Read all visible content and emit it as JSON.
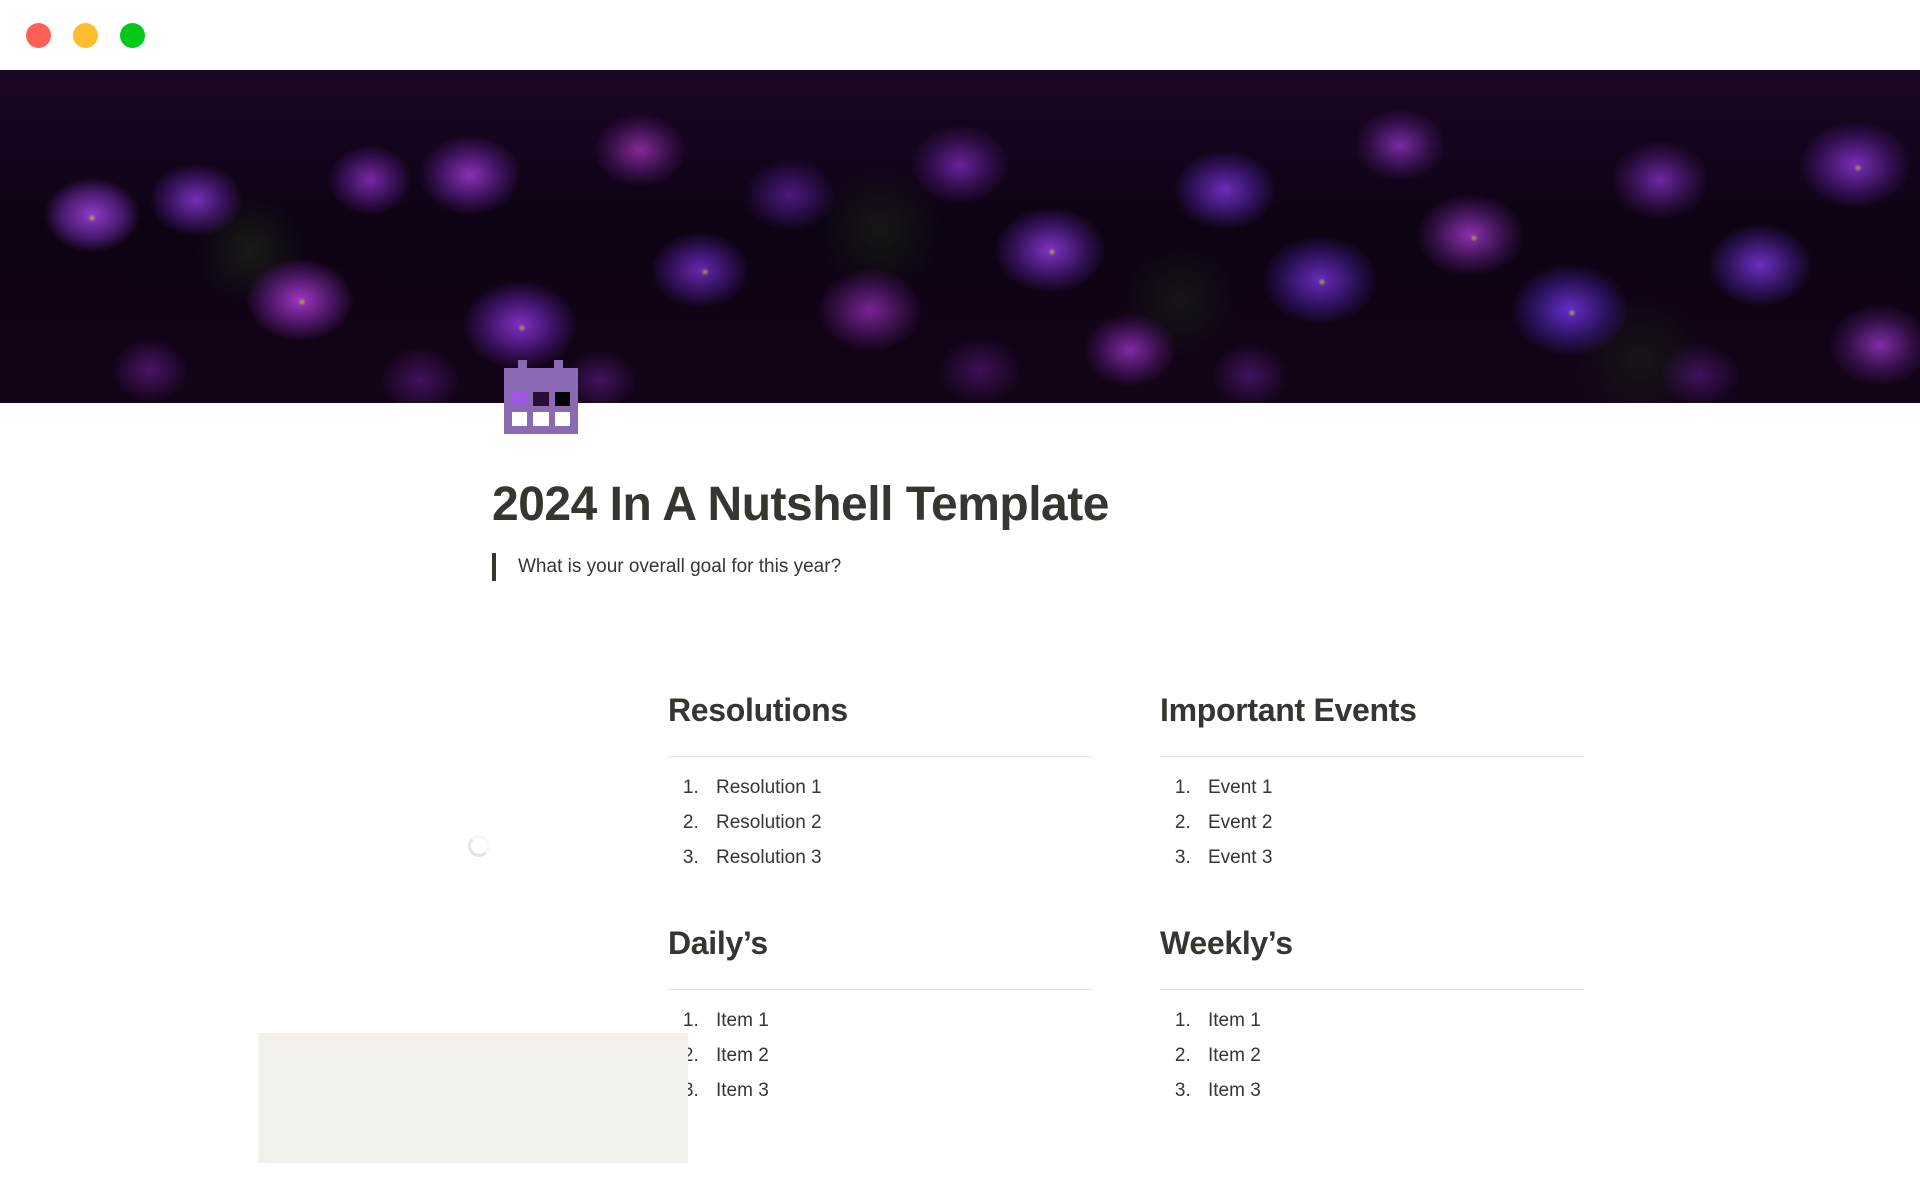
{
  "window": {
    "traffic_lights": [
      {
        "name": "close",
        "color": "#FF5F57"
      },
      {
        "name": "minimize",
        "color": "#FEBC2E"
      },
      {
        "name": "maximize",
        "color": "#00C91B"
      }
    ]
  },
  "cover": {
    "alt": "dark photograph of purple aubrieta flowers",
    "dominant_color": "#7B2FB5"
  },
  "page": {
    "icon": "calendar-icon",
    "icon_color": "#8A6BB3",
    "title": "2024 In A Nutshell Template",
    "quote": "What is your overall goal for this year?"
  },
  "columns": {
    "left": {
      "loading": true,
      "placeholder_color": "#F3EFEA"
    },
    "middle": [
      {
        "heading": "Resolutions",
        "items": [
          "Resolution 1",
          "Resolution 2",
          "Resolution 3"
        ]
      },
      {
        "heading": "Daily’s",
        "items": [
          "Item 1",
          "Item 2",
          "Item 3"
        ]
      }
    ],
    "right": [
      {
        "heading": "Important Events",
        "items": [
          "Event 1",
          "Event 2",
          "Event 3"
        ]
      },
      {
        "heading": "Weekly’s",
        "items": [
          "Item 1",
          "Item 2",
          "Item 3"
        ]
      }
    ]
  },
  "theme": {
    "text_color": "#37352F",
    "rule_color": "#E3E2E0",
    "background": "#FFFFFF"
  }
}
